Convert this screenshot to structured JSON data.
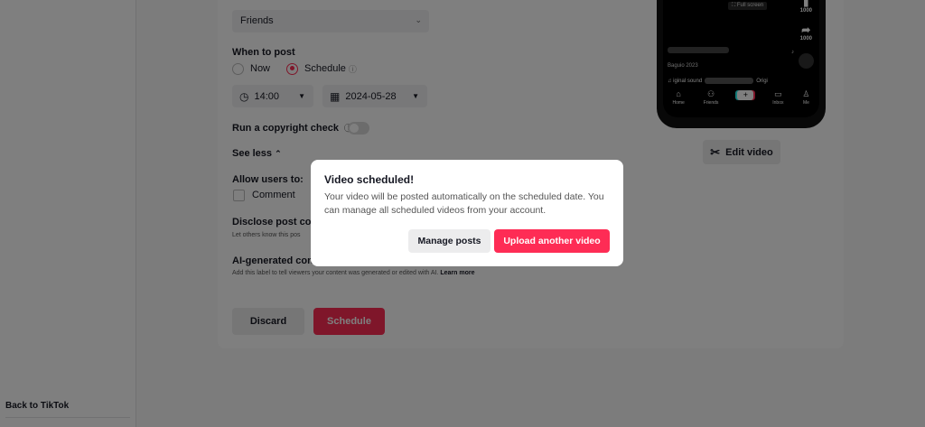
{
  "sidebar": {
    "back_link": "Back to TikTok"
  },
  "form": {
    "visibility_value": "Friends",
    "when_to_post_label": "When to post",
    "option_now": "Now",
    "option_schedule": "Schedule",
    "time_value": "14:00",
    "date_value": "2024-05-28",
    "copyright_label": "Run a copyright check",
    "see_less": "See less",
    "allow_users_label": "Allow users to:",
    "comment_label": "Comment",
    "disclose_label": "Disclose post cont",
    "disclose_help": "Let others know this pos",
    "ai_label": "AI-generated cont",
    "ai_help": "Add this label to tell viewers your content was generated or edited with AI.",
    "learn_more": "Learn more",
    "discard_button": "Discard",
    "schedule_button": "Schedule"
  },
  "preview": {
    "fullscreen_label": "Full screen",
    "like_count": "1000",
    "share_count": "1000",
    "caption": "Baguio 2023",
    "sound_prefix": "♫ iginal sound",
    "sound_suffix": "Origi",
    "nav": [
      "Home",
      "Friends",
      "",
      "Inbox",
      "Me"
    ],
    "edit_video_button": "Edit video"
  },
  "modal": {
    "title": "Video scheduled!",
    "body": "Your video will be posted automatically on the scheduled date. You can manage all scheduled videos from your account.",
    "manage_button": "Manage posts",
    "upload_button": "Upload another video"
  },
  "colors": {
    "accent": "#fe2c55",
    "overlay": "rgba(0,0,0,0.5)"
  }
}
